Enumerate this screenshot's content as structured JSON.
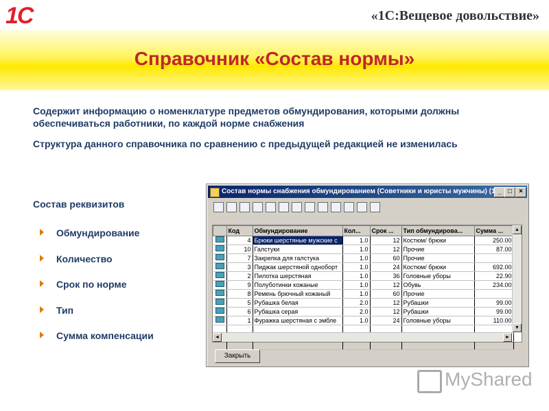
{
  "header": {
    "logo": "1С",
    "product": "«1С:Вещевое довольствие»"
  },
  "slide": {
    "title": "Справочник «Состав нормы»",
    "paragraph1": "Содержит информацию о номенклатуре предметов обмундирования, которыми должны обеспечиваться работники, по каждой норме снабжения",
    "paragraph2": "Структура данного справочника по сравнению с предыдущей редакцией не изменилась",
    "requisites_title": "Состав реквизитов",
    "requisites": [
      "Обмундирование",
      "Количество",
      "Срок по норме",
      "Тип",
      "Сумма компенсации"
    ]
  },
  "window": {
    "title": "Состав нормы снабжения обмундированием (Советники и юристы мужчины) (1...",
    "minimize": "_",
    "maximize": "□",
    "close": "×",
    "close_button": "Закрыть",
    "columns": [
      "Код",
      "Обмундирование",
      "Кол...",
      "Срок ...",
      "Тип обмундирова...",
      "Сумма ..."
    ],
    "rows": [
      {
        "code": "4",
        "item": "Брюки шерстяные мужские с",
        "qty": "1.0",
        "term": "12",
        "type": "Костюм/ брюки",
        "sum": "250.00"
      },
      {
        "code": "10",
        "item": "Галстуки",
        "qty": "1.0",
        "term": "12",
        "type": "Прочие",
        "sum": "87.00"
      },
      {
        "code": "7",
        "item": "Закрепка для галстука",
        "qty": "1.0",
        "term": "60",
        "type": "Прочие",
        "sum": ""
      },
      {
        "code": "3",
        "item": "Пиджак шерстяной одноборт",
        "qty": "1.0",
        "term": "24",
        "type": "Костюм/ брюки",
        "sum": "692.00"
      },
      {
        "code": "2",
        "item": "Пилотка шерстяная",
        "qty": "1.0",
        "term": "36",
        "type": "Головные уборы",
        "sum": "22.90"
      },
      {
        "code": "9",
        "item": "Полуботинки кожаные",
        "qty": "1.0",
        "term": "12",
        "type": "Обувь",
        "sum": "234.00"
      },
      {
        "code": "8",
        "item": "Ремень брючный кожаный",
        "qty": "1.0",
        "term": "60",
        "type": "Прочие",
        "sum": ""
      },
      {
        "code": "5",
        "item": "Рубашка белая",
        "qty": "2.0",
        "term": "12",
        "type": "Рубашки",
        "sum": "99.00"
      },
      {
        "code": "6",
        "item": "Рубашка серая",
        "qty": "2.0",
        "term": "12",
        "type": "Рубашки",
        "sum": "99.00"
      },
      {
        "code": "1",
        "item": "Фуражка шерстяная с эмбле",
        "qty": "1.0",
        "term": "24",
        "type": "Головные уборы",
        "sum": "110.00"
      }
    ],
    "toolbar_icons": [
      "add-icon",
      "copy-icon",
      "search-icon",
      "edit-icon",
      "delete-icon",
      "group-icon",
      "move-icon",
      "list-icon",
      "doc-icon",
      "hierarchy-icon",
      "filter-icon",
      "help-icon",
      "cursor-help-icon"
    ]
  },
  "watermark": "MyShared",
  "colors": {
    "title": "#c0262c",
    "text": "#1f3b66",
    "band": "#ffe800",
    "logo": "#e2202a"
  }
}
